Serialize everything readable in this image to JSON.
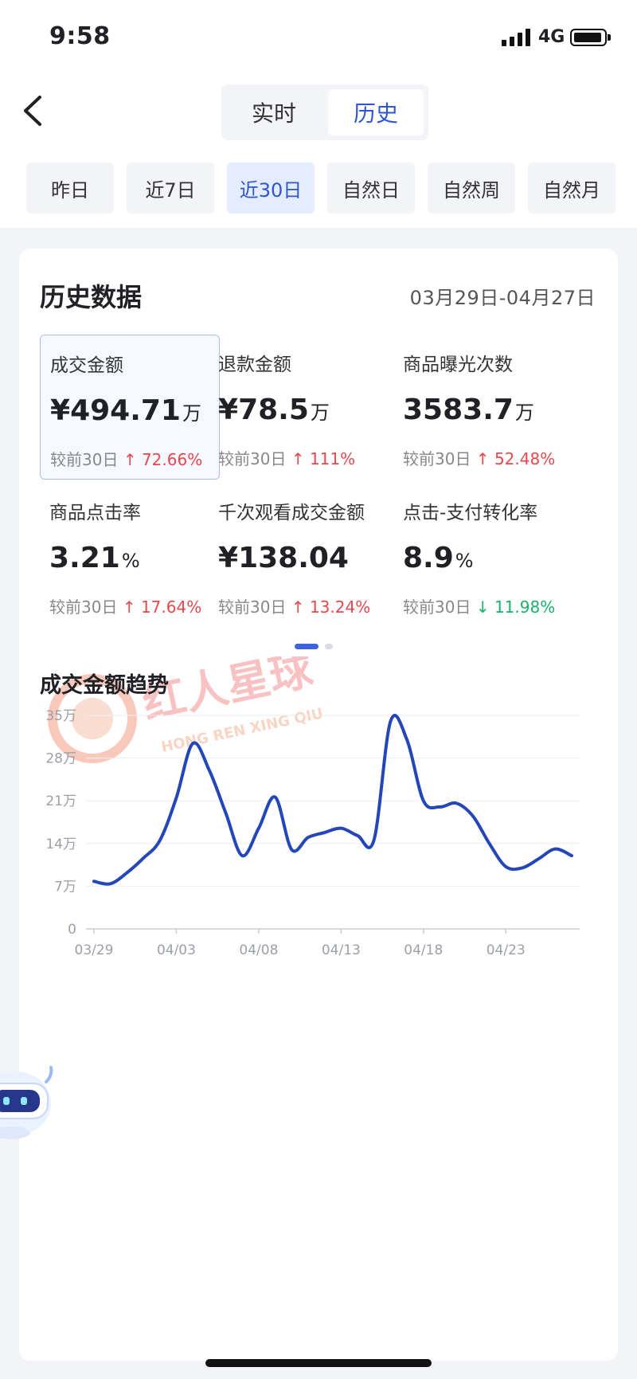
{
  "status_bar": {
    "time": "9:58",
    "network": "4G"
  },
  "header": {
    "tabs": [
      {
        "label": "实时"
      },
      {
        "label": "历史",
        "active": true
      }
    ],
    "ranges": [
      {
        "label": "昨日"
      },
      {
        "label": "近7日"
      },
      {
        "label": "近30日",
        "active": true
      },
      {
        "label": "自然日"
      },
      {
        "label": "自然周"
      },
      {
        "label": "自然月"
      }
    ]
  },
  "card": {
    "title": "历史数据",
    "date_range": "03月29日-04月27日",
    "metrics": [
      {
        "label": "成交金额",
        "prefix": "¥",
        "value": "494.71",
        "unit": "万",
        "compare": "较前30日",
        "arrow": "↑",
        "change": "72.66%",
        "direction": "up",
        "selected": true
      },
      {
        "label": "退款金额",
        "prefix": "¥",
        "value": "78.5",
        "unit": "万",
        "compare": "较前30日",
        "arrow": "↑",
        "change": "111%",
        "direction": "up"
      },
      {
        "label": "商品曝光次数",
        "prefix": "",
        "value": "3583.7",
        "unit": "万",
        "compare": "较前30日",
        "arrow": "↑",
        "change": "52.48%",
        "direction": "up"
      },
      {
        "label": "商品点击率",
        "prefix": "",
        "value": "3.21",
        "unit": "%",
        "compare": "较前30日",
        "arrow": "↑",
        "change": "17.64%",
        "direction": "up"
      },
      {
        "label": "千次观看成交金额",
        "prefix": "¥",
        "value": "138.04",
        "unit": "",
        "compare": "较前30日",
        "arrow": "↑",
        "change": "13.24%",
        "direction": "up"
      },
      {
        "label": "点击-支付转化率",
        "prefix": "",
        "value": "8.9",
        "unit": "%",
        "compare": "较前30日",
        "arrow": "↓",
        "change": "11.98%",
        "direction": "down"
      }
    ]
  },
  "watermark": {
    "text": "红人星球",
    "subtext": "HONG REN XING QIU"
  },
  "colors": {
    "accent": "#2f55d4",
    "line": "#2346b8",
    "up": "#e8474b",
    "down": "#18b26c"
  },
  "chart_data": {
    "type": "line",
    "title": "成交金额趋势",
    "y_tick_labels": [
      "0",
      "7万",
      "14万",
      "21万",
      "28万",
      "35万"
    ],
    "y_ticks": [
      0,
      7,
      14,
      21,
      28,
      35
    ],
    "ylim": [
      0,
      35
    ],
    "y_unit": "万",
    "x_tick_labels": [
      "03/29",
      "04/03",
      "04/08",
      "04/13",
      "04/18",
      "04/23"
    ],
    "categories": [
      "03/29",
      "03/30",
      "03/31",
      "04/01",
      "04/02",
      "04/03",
      "04/04",
      "04/05",
      "04/06",
      "04/07",
      "04/08",
      "04/09",
      "04/10",
      "04/11",
      "04/12",
      "04/13",
      "04/14",
      "04/15",
      "04/16",
      "04/17",
      "04/18",
      "04/19",
      "04/20",
      "04/21",
      "04/22",
      "04/23",
      "04/24",
      "04/25",
      "04/26",
      "04/27"
    ],
    "series": [
      {
        "values": [
          7.8,
          7.4,
          9.2,
          11.6,
          14.5,
          21.5,
          30.4,
          26.0,
          19.0,
          12.0,
          16.5,
          21.6,
          13.0,
          15.0,
          15.8,
          16.5,
          15.3,
          14.6,
          34.0,
          31.0,
          21.0,
          20.0,
          20.6,
          18.5,
          14.0,
          10.2,
          10.0,
          11.5,
          13.1,
          12.0
        ]
      }
    ],
    "grid": true
  }
}
